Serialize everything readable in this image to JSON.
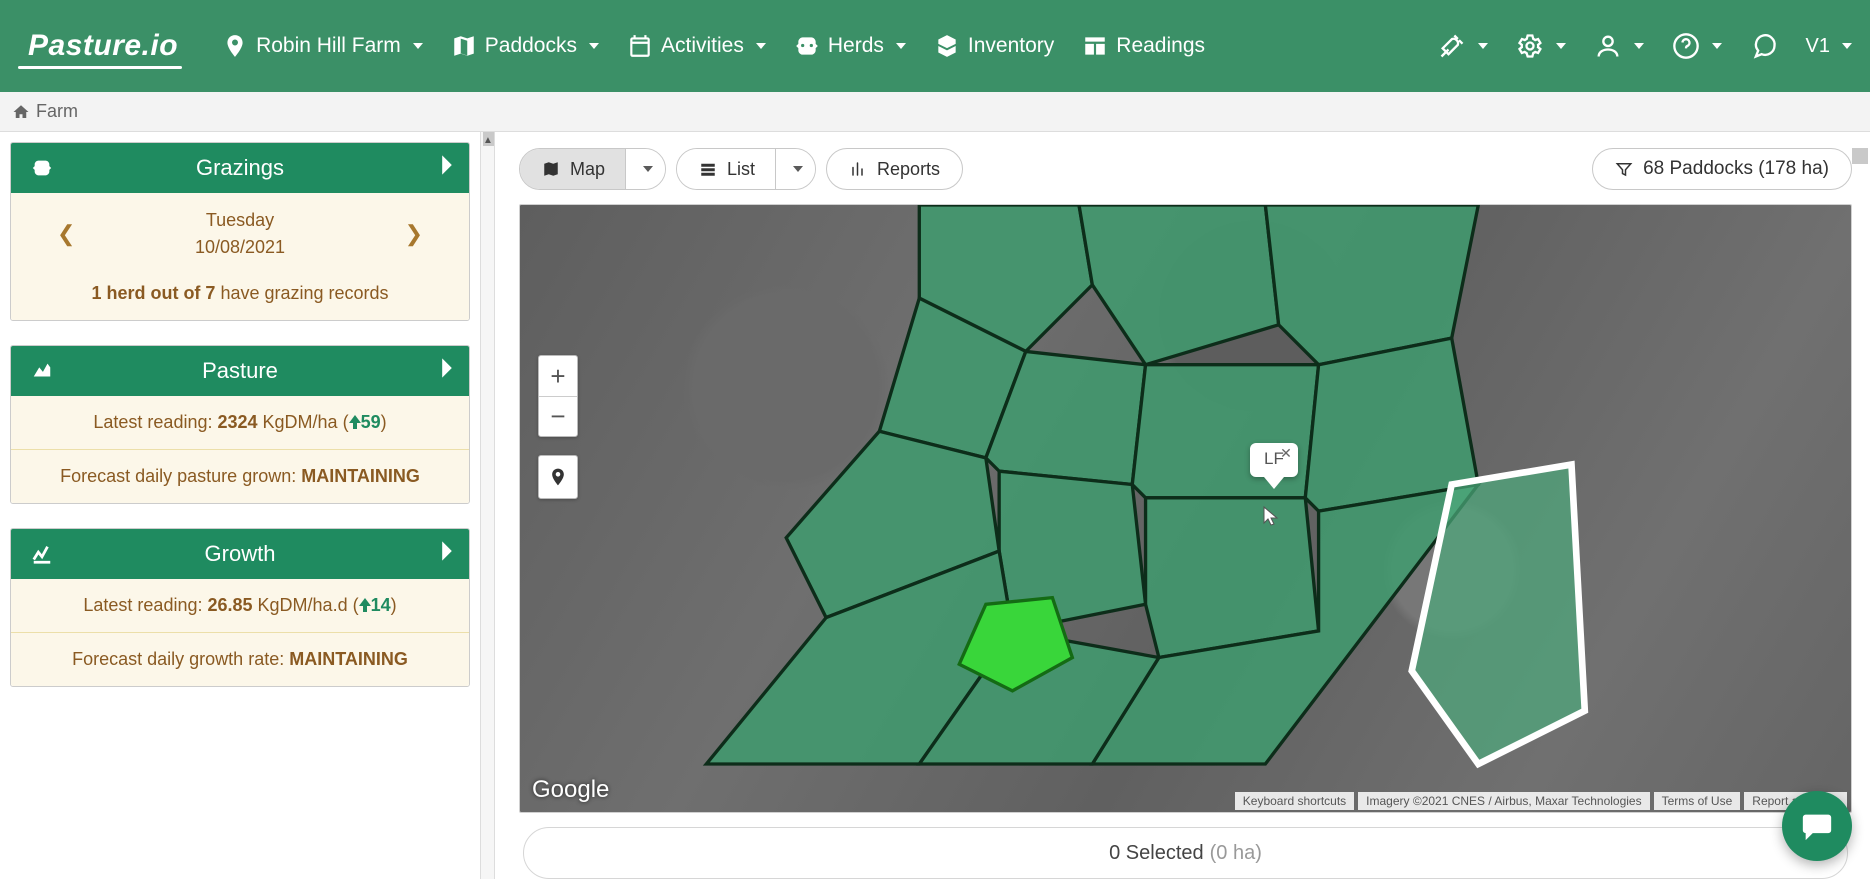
{
  "brand": "Pasture.io",
  "nav": {
    "farm": "Robin Hill Farm",
    "paddocks": "Paddocks",
    "activities": "Activities",
    "herds": "Herds",
    "inventory": "Inventory",
    "readings": "Readings",
    "version": "V1"
  },
  "breadcrumb": {
    "label": "Farm"
  },
  "cards": {
    "grazings": {
      "title": "Grazings",
      "day": "Tuesday",
      "date": "10/08/2021",
      "summary_prefix": "1 herd out of 7",
      "summary_suffix": " have grazing records"
    },
    "pasture": {
      "title": "Pasture",
      "latest_label": "Latest reading: ",
      "latest_value": "2324",
      "latest_unit": " KgDM/ha (",
      "delta": "59",
      "close": ")",
      "forecast_label": "Forecast daily pasture grown: ",
      "forecast_value": "MAINTAINING"
    },
    "growth": {
      "title": "Growth",
      "latest_label": "Latest reading: ",
      "latest_value": "26.85",
      "latest_unit": " KgDM/ha.d (",
      "delta": "14",
      "close": ")",
      "forecast_label": "Forecast daily growth rate: ",
      "forecast_value": "MAINTAINING"
    }
  },
  "toolbar": {
    "map": "Map",
    "list": "List",
    "reports": "Reports",
    "filter": "68 Paddocks (178 ha)"
  },
  "map": {
    "callout_label": "LF",
    "google": "Google",
    "attrib1": "Keyboard shortcuts",
    "attrib2": "Imagery ©2021 CNES / Airbus, Maxar Technologies",
    "attrib3": "Terms of Use",
    "attrib4": "Report a map er"
  },
  "selection": {
    "count_label": "0 Selected",
    "area_label": "(0 ha)"
  }
}
